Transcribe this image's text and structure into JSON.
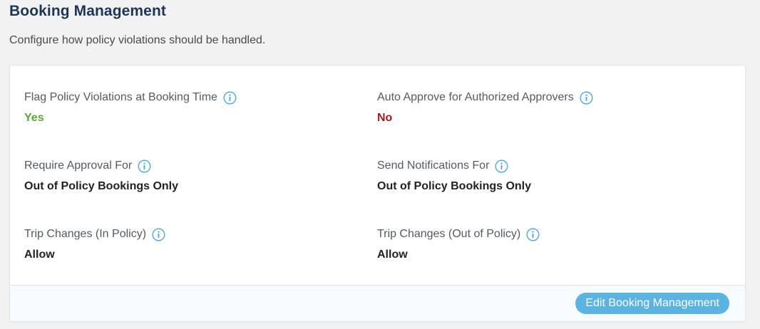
{
  "header": {
    "title": "Booking Management",
    "subtitle": "Configure how policy violations should be handled."
  },
  "settings": [
    {
      "label": "Flag Policy Violations at Booking Time",
      "value": "Yes",
      "status": "positive",
      "icon": "info-icon"
    },
    {
      "label": "Auto Approve for Authorized Approvers",
      "value": "No",
      "status": "negative",
      "icon": "info-icon"
    },
    {
      "label": "Require Approval For",
      "value": "Out of Policy Bookings Only",
      "status": "neutral",
      "icon": "info-icon"
    },
    {
      "label": "Send Notifications For",
      "value": "Out of Policy Bookings Only",
      "status": "neutral",
      "icon": "info-icon"
    },
    {
      "label": "Trip Changes (In Policy)",
      "value": "Allow",
      "status": "neutral",
      "icon": "info-icon"
    },
    {
      "label": "Trip Changes (Out of Policy)",
      "value": "Allow",
      "status": "neutral",
      "icon": "info-icon"
    }
  ],
  "footer": {
    "edit_button_label": "Edit Booking Management"
  },
  "colors": {
    "title": "#1d3556",
    "positive": "#5aa83a",
    "negative": "#9b1c1c",
    "accent": "#5bb3e0"
  }
}
